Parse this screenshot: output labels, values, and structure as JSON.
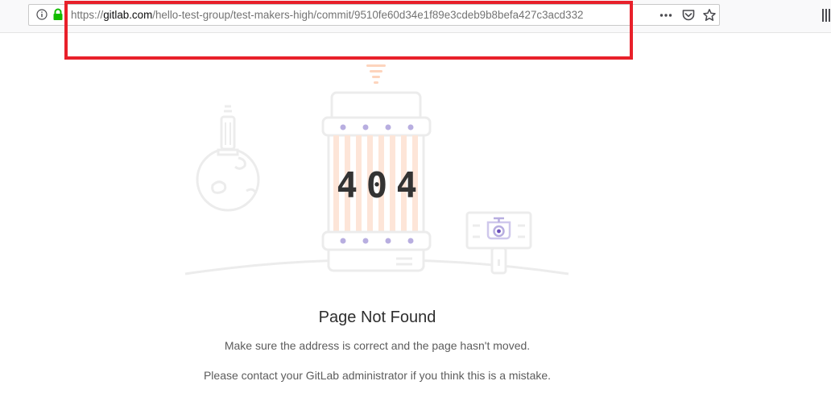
{
  "browser": {
    "url_prefix": "https://",
    "url_host": "gitlab.com",
    "url_path": "/hello-test-group/test-makers-high/commit/9510fe60d34e1f89e3cdeb9b8befa427c3acd332",
    "icons": [
      "info-icon",
      "lock-icon",
      "page-actions-menu-icon",
      "pocket-icon",
      "bookmark-star-icon",
      "library-icon"
    ]
  },
  "illustration": {
    "code": [
      "4",
      "0",
      "4"
    ],
    "colors": {
      "outline": "#ececec",
      "stripe": "#fde5d8",
      "dot": "#b8aee0",
      "digit": "#333333",
      "signal": "#fdd4bd",
      "eye": "#6b4fbb"
    }
  },
  "error": {
    "title": "Page Not Found",
    "line1": "Make sure the address is correct and the page hasn't moved.",
    "line2": "Please contact your GitLab administrator if you think this is a mistake."
  },
  "annotation": {
    "highlight_color": "#e8202a"
  }
}
